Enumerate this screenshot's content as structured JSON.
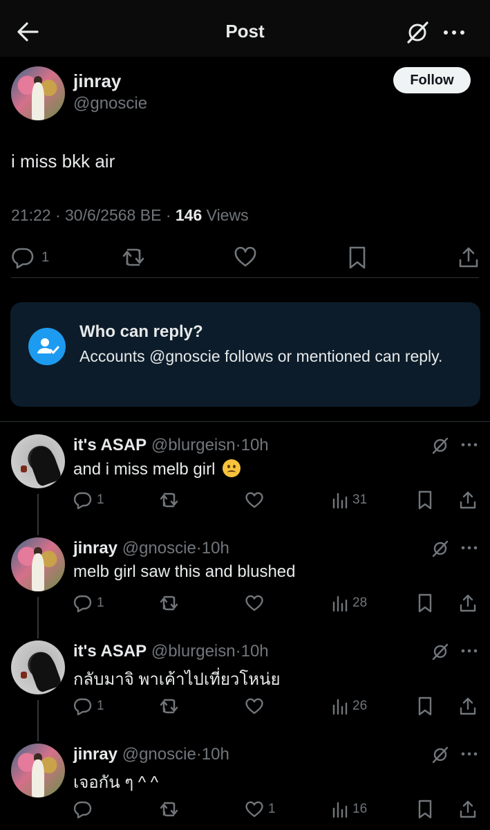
{
  "header": {
    "title": "Post",
    "back_icon": "arrow-left-icon",
    "grok_icon": "grok-icon",
    "more_icon": "more-icon"
  },
  "post": {
    "author_name": "jinray",
    "author_handle": "@gnoscie",
    "follow_label": "Follow",
    "text": "i miss bkk air",
    "time": "21:22",
    "date": "30/6/2568 BE",
    "views_count": "146",
    "views_label": "Views",
    "reply_count": "1"
  },
  "who_can_reply": {
    "title": "Who can reply?",
    "body": "Accounts @gnoscie follows or mentioned can reply."
  },
  "replies": [
    {
      "name": "it's ASAP",
      "handle": "@blurgeisn",
      "time": "10h",
      "text": "and i miss melb girl",
      "emoji": "slightly-frowning-face",
      "replies": "1",
      "likes": "",
      "views": "31",
      "avatar": "asap"
    },
    {
      "name": "jinray",
      "handle": "@gnoscie",
      "time": "10h",
      "text": "melb girl saw this and blushed",
      "replies": "1",
      "likes": "",
      "views": "28",
      "avatar": "jin"
    },
    {
      "name": "it's ASAP",
      "handle": "@blurgeisn",
      "time": "10h",
      "text": "กลับมาจิ พาเค้าไปเที่ยวโหน่ย",
      "replies": "1",
      "likes": "",
      "views": "26",
      "avatar": "asap"
    },
    {
      "name": "jinray",
      "handle": "@gnoscie",
      "time": "10h",
      "text": "เจอกัน ๆ ^   ^",
      "replies": "",
      "likes": "1",
      "views": "16",
      "avatar": "jin"
    }
  ],
  "separator": "·",
  "colors": {
    "background": "#000000",
    "text": "#e7e9ea",
    "muted": "#71767b",
    "accent": "#1d9bf0",
    "card": "#0c1c2a"
  }
}
